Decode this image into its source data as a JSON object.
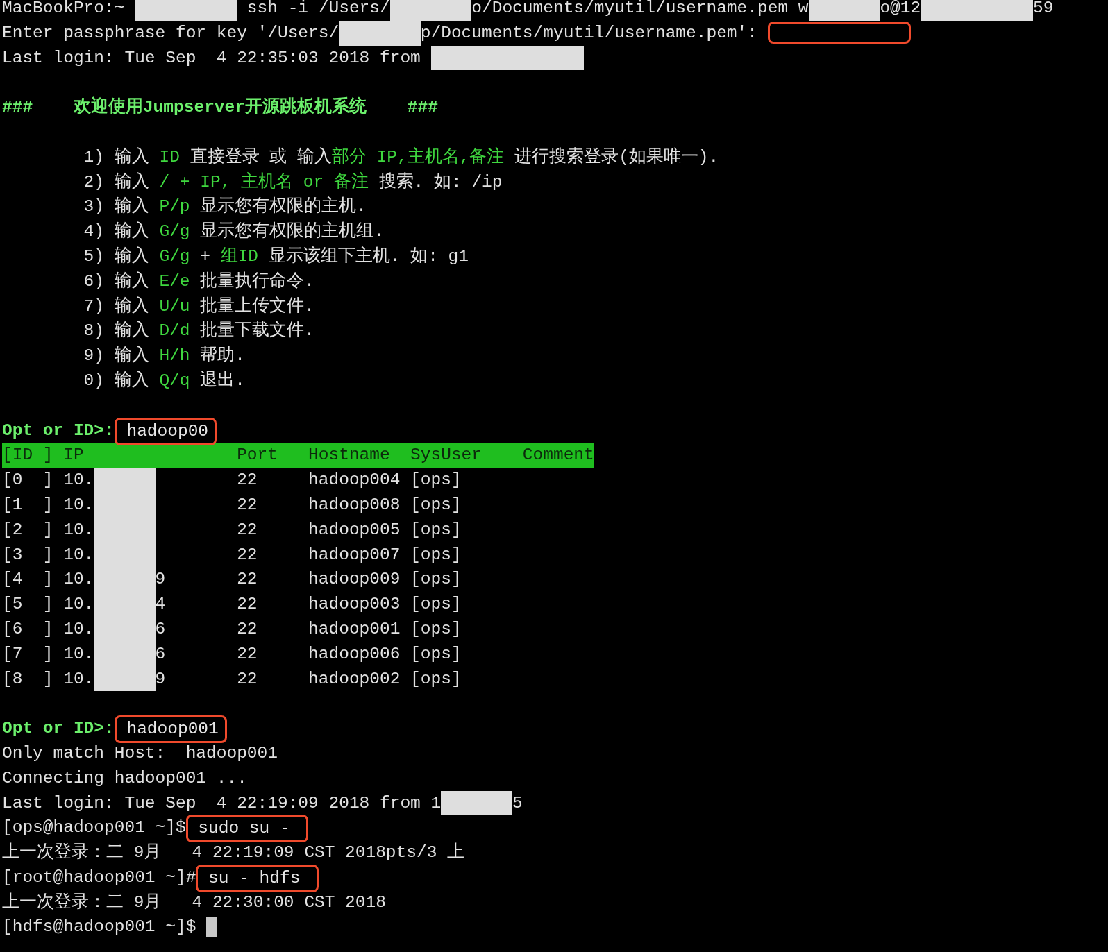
{
  "terminal": {
    "lines": [
      {
        "kind": "text",
        "segments": [
          {
            "kind": "plain",
            "text": "MacBookPro:~ "
          },
          {
            "kind": "redaction"
          },
          {
            "kind": "plain",
            "text": " ssh -i /Users/"
          },
          {
            "kind": "redaction"
          },
          {
            "kind": "plain",
            "text": "o/Documents/myutil/username.pem w"
          },
          {
            "kind": "redaction"
          },
          {
            "kind": "plain",
            "text": "o@12"
          },
          {
            "kind": "redaction"
          },
          {
            "kind": "plain",
            "text": "59"
          }
        ]
      },
      {
        "kind": "text",
        "segments": [
          {
            "kind": "plain",
            "text": "Enter passphrase for key '/Users/"
          },
          {
            "kind": "redaction"
          },
          {
            "kind": "plain",
            "text": "p/Documents/myutil/username.pem':"
          },
          {
            "kind": "annotation"
          }
        ]
      },
      {
        "kind": "text",
        "segments": [
          {
            "kind": "plain",
            "text": "Last login: Tue Sep  4 22:35:03 2018 from "
          },
          {
            "kind": "redaction"
          }
        ]
      },
      {
        "kind": "blank"
      },
      {
        "kind": "text",
        "segments": [
          {
            "kind": "prompt",
            "text": "###    欢迎使用Jumpserver开源跳板机系统    ###"
          }
        ]
      },
      {
        "kind": "blank"
      },
      {
        "kind": "text",
        "segments": [
          {
            "kind": "plain",
            "text": "        1) 输入 "
          },
          {
            "kind": "accent",
            "text": "ID"
          },
          {
            "kind": "plain",
            "text": " 直接登录 或 输入"
          },
          {
            "kind": "accent",
            "text": "部分 IP,主机名,备注"
          },
          {
            "kind": "plain",
            "text": " 进行搜索登录(如果唯一)."
          }
        ]
      },
      {
        "kind": "text",
        "segments": [
          {
            "kind": "plain",
            "text": "        2) 输入 "
          },
          {
            "kind": "accent",
            "text": "/ + IP, 主机名 or 备注"
          },
          {
            "kind": "plain",
            "text": " 搜索. 如: /ip"
          }
        ]
      },
      {
        "kind": "text",
        "segments": [
          {
            "kind": "plain",
            "text": "        3) 输入 "
          },
          {
            "kind": "accent",
            "text": "P/p"
          },
          {
            "kind": "plain",
            "text": " 显示您有权限的主机."
          }
        ]
      },
      {
        "kind": "text",
        "segments": [
          {
            "kind": "plain",
            "text": "        4) 输入 "
          },
          {
            "kind": "accent",
            "text": "G/g"
          },
          {
            "kind": "plain",
            "text": " 显示您有权限的主机组."
          }
        ]
      },
      {
        "kind": "text",
        "segments": [
          {
            "kind": "plain",
            "text": "        5) 输入 "
          },
          {
            "kind": "accent",
            "text": "G/g"
          },
          {
            "kind": "plain",
            "text": " + "
          },
          {
            "kind": "accent",
            "text": "组ID"
          },
          {
            "kind": "plain",
            "text": " 显示该组下主机. 如: g1"
          }
        ]
      },
      {
        "kind": "text",
        "segments": [
          {
            "kind": "plain",
            "text": "        6) 输入 "
          },
          {
            "kind": "accent",
            "text": "E/e"
          },
          {
            "kind": "plain",
            "text": " 批量执行命令."
          }
        ]
      },
      {
        "kind": "text",
        "segments": [
          {
            "kind": "plain",
            "text": "        7) 输入 "
          },
          {
            "kind": "accent",
            "text": "U/u"
          },
          {
            "kind": "plain",
            "text": " 批量上传文件."
          }
        ]
      },
      {
        "kind": "text",
        "segments": [
          {
            "kind": "plain",
            "text": "        8) 输入 "
          },
          {
            "kind": "accent",
            "text": "D/d"
          },
          {
            "kind": "plain",
            "text": " 批量下载文件."
          }
        ]
      },
      {
        "kind": "text",
        "segments": [
          {
            "kind": "plain",
            "text": "        9) 输入 "
          },
          {
            "kind": "accent",
            "text": "H/h"
          },
          {
            "kind": "plain",
            "text": " 帮助."
          }
        ]
      },
      {
        "kind": "text",
        "segments": [
          {
            "kind": "plain",
            "text": "        0) 输入 "
          },
          {
            "kind": "accent",
            "text": "Q/q"
          },
          {
            "kind": "plain",
            "text": " 退出."
          }
        ]
      },
      {
        "kind": "blank"
      },
      {
        "kind": "text",
        "segments": [
          {
            "kind": "prompt",
            "text": "Opt or ID>:"
          },
          {
            "kind": "input",
            "text": " hadoop00"
          }
        ]
      },
      {
        "kind": "header",
        "text": "[ID ] IP               Port   Hostname  SysUser    Comment"
      },
      {
        "kind": "text",
        "segments": [
          {
            "kind": "plain",
            "text": "[0  ] 10."
          },
          {
            "kind": "redaction"
          },
          {
            "kind": "plain",
            "text": "        22     hadoop004 [ops]"
          }
        ]
      },
      {
        "kind": "text",
        "segments": [
          {
            "kind": "plain",
            "text": "[1  ] 10."
          },
          {
            "kind": "redaction"
          },
          {
            "kind": "plain",
            "text": "        22     hadoop008 [ops]"
          }
        ]
      },
      {
        "kind": "text",
        "segments": [
          {
            "kind": "plain",
            "text": "[2  ] 10."
          },
          {
            "kind": "redaction"
          },
          {
            "kind": "plain",
            "text": "        22     hadoop005 [ops]"
          }
        ]
      },
      {
        "kind": "text",
        "segments": [
          {
            "kind": "plain",
            "text": "[3  ] 10."
          },
          {
            "kind": "redaction"
          },
          {
            "kind": "plain",
            "text": "        22     hadoop007 [ops]"
          }
        ]
      },
      {
        "kind": "text",
        "segments": [
          {
            "kind": "plain",
            "text": "[4  ] 10."
          },
          {
            "kind": "redaction"
          },
          {
            "kind": "plain",
            "text": "9       22     hadoop009 [ops]"
          }
        ]
      },
      {
        "kind": "text",
        "segments": [
          {
            "kind": "plain",
            "text": "[5  ] 10."
          },
          {
            "kind": "redaction"
          },
          {
            "kind": "plain",
            "text": "4       22     hadoop003 [ops]"
          }
        ]
      },
      {
        "kind": "text",
        "segments": [
          {
            "kind": "plain",
            "text": "[6  ] 10."
          },
          {
            "kind": "redaction"
          },
          {
            "kind": "plain",
            "text": "6       22     hadoop001 [ops]"
          }
        ]
      },
      {
        "kind": "text",
        "segments": [
          {
            "kind": "plain",
            "text": "[7  ] 10."
          },
          {
            "kind": "redaction"
          },
          {
            "kind": "plain",
            "text": "6       22     hadoop006 [ops]"
          }
        ]
      },
      {
        "kind": "text",
        "segments": [
          {
            "kind": "plain",
            "text": "[8  ] 10."
          },
          {
            "kind": "redaction"
          },
          {
            "kind": "plain",
            "text": "9       22     hadoop002 [ops]"
          }
        ]
      },
      {
        "kind": "blank"
      },
      {
        "kind": "text",
        "segments": [
          {
            "kind": "prompt",
            "text": "Opt or ID>:"
          },
          {
            "kind": "input",
            "text": " hadoop001"
          }
        ]
      },
      {
        "kind": "text",
        "segments": [
          {
            "kind": "plain",
            "text": "Only match Host:  hadoop001"
          }
        ]
      },
      {
        "kind": "text",
        "segments": [
          {
            "kind": "plain",
            "text": "Connecting hadoop001 ..."
          }
        ]
      },
      {
        "kind": "text",
        "segments": [
          {
            "kind": "plain",
            "text": "Last login: Tue Sep  4 22:19:09 2018 from 1"
          },
          {
            "kind": "redaction"
          },
          {
            "kind": "plain",
            "text": "5"
          }
        ]
      },
      {
        "kind": "text",
        "segments": [
          {
            "kind": "plain",
            "text": "[ops@hadoop001 ~]$"
          },
          {
            "kind": "input",
            "text": " sudo su - "
          }
        ]
      },
      {
        "kind": "text",
        "segments": [
          {
            "kind": "plain",
            "text": "上一次登录：二 9月   4 22:19:09 CST 2018pts/3 上"
          }
        ]
      },
      {
        "kind": "text",
        "segments": [
          {
            "kind": "plain",
            "text": "[root@hadoop001 ~]#"
          },
          {
            "kind": "input",
            "text": " su - hdfs "
          }
        ]
      },
      {
        "kind": "text",
        "segments": [
          {
            "kind": "plain",
            "text": "上一次登录：二 9月   4 22:30:00 CST 2018"
          }
        ]
      },
      {
        "kind": "text",
        "segments": [
          {
            "kind": "plain",
            "text": "[hdfs@hadoop001 ~]$ "
          },
          {
            "kind": "cursor"
          }
        ]
      }
    ]
  }
}
